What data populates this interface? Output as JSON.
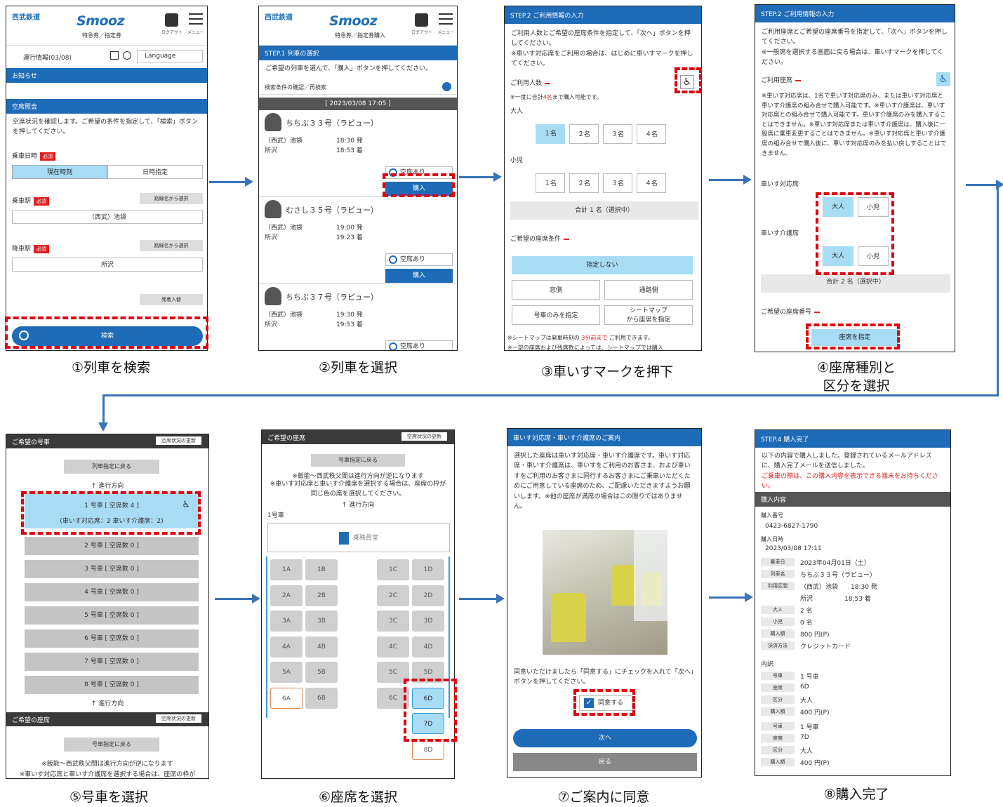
{
  "colors": {
    "accent": "#1e6bb8",
    "highlight": "#a8dcf5",
    "required": "#e02020",
    "flow_arrow": "#3a73b8"
  },
  "captions": [
    "①列車を検索",
    "②列車を選択",
    "③車いすマークを押下",
    "④座席種別と",
    "区分を選択",
    "⑤号車を選択",
    "⑥座席を選択",
    "⑦ご案内に同意",
    "⑧購入完了"
  ],
  "header": {
    "brand": "西武鉄道",
    "product": "Smooz",
    "sub1": "特急券／指定券",
    "sub2": "特急券／指定券購入",
    "logout": "ログアウト",
    "menu": "メニュー"
  },
  "s1": {
    "info": "運行情報(03/08)",
    "language": "Language",
    "notice": "お知らせ",
    "section": "空席照会",
    "desc": "空席状況を確認します。ご希望の条件を指定して、「検索」ボタンを押してください。",
    "date_label": "乗車日時",
    "required": "必須",
    "now": "現在時刻",
    "date_spec": "日時指定",
    "dep_label": "乗車駅",
    "line_select": "路線名から選択",
    "dep_value": "（西武）池袋",
    "arr_label": "降車駅",
    "arr_value": "所沢",
    "swap": "発着入替",
    "search": "検索"
  },
  "s2": {
    "step": "STEP.1 列車の選択",
    "desc": "ご希望の列車を選んで、「購入」ボタンを押してください。",
    "recheck": "検索条件の確認／再検索",
    "datetime": "[ 2023/03/08 17:05 ]",
    "avail": "空席あり",
    "buy": "購入",
    "trains": [
      {
        "name": "ちちぶ３３号（ラビュー）",
        "from": "（西武）池袋",
        "dep": "18:30 発",
        "to": "所沢",
        "arr": "18:53 着"
      },
      {
        "name": "むさし３５号（ラビュー）",
        "from": "（西武）池袋",
        "dep": "19:00 発",
        "to": "所沢",
        "arr": "19:23 着"
      },
      {
        "name": "ちちぶ３７号（ラビュー）",
        "from": "（西武）池袋",
        "dep": "19:30 発",
        "to": "所沢",
        "arr": "19:53 着"
      }
    ]
  },
  "s3": {
    "step": "STEP.2 ご利用情報の入力",
    "desc1": "ご利用人数とご希望の座席条件を指定して、「次へ」ボタンを押してください。",
    "desc2": "※車いす対応席をご利用の場合は、はじめに車いすマークを押してください。",
    "count_label": "ご利用人数",
    "limit_pre": "※一度に合計",
    "limit_num": "4名",
    "limit_post": "まで購入可能です。",
    "adult": "大人",
    "child": "小児",
    "counts": [
      "１名",
      "２名",
      "３名",
      "４名"
    ],
    "total": "合計 1 名（選択中）",
    "seat_cond": "ご希望の座席条件",
    "none": "指定しない",
    "window": "窓側",
    "aisle": "通路側",
    "car_only": "号車のみを指定",
    "seatmap1": "シートマップ",
    "seatmap2": "から座席を指定",
    "note1_pre": "※シートマップは発車時刻の",
    "note1_red": "3分前まで",
    "note1_post": "ご利用できます。",
    "note2": "※一部の座席および残席数によっては、シートマップでは購入"
  },
  "s4": {
    "step": "STEP.2 ご利用情報の入力",
    "desc1": "ご利用座席とご希望の座席番号を指定して、「次へ」ボタンを押してください。",
    "desc2": "※一般席を選択する画面に戻る場合は、車いすマークを押してください。",
    "seat_label": "ご利用座席",
    "notes": "※車いす対応席は、1名で車いす対応席のみ、または車いす対応席と車いす介護席の組み合せで購入可能です。※車いす介護席は、車いす対応席との組み合せで購入可能です。車いす介護席のみを購入することはできません。※車いす対応席または車いす介護席は、購入後に一般席に乗車変更することはできません。※車いす対応席と車いす介護席の組み合せで購入後に、車いす対応席のみを払い戻しすることはできません。",
    "wc": "車いす対応席",
    "care": "車いす介護席",
    "adult": "大人",
    "child": "小児",
    "total": "合計 2 名（選択中）",
    "seatno": "ご希望の座席番号",
    "pick": "座席を指定"
  },
  "s5": {
    "title": "ご希望の号車",
    "refresh": "空席状況の更新",
    "back": "列車指定に戻る",
    "direction": "↑ 進行方向",
    "car1": "1 号車 [ 空席数 4 ]",
    "car1_sub": "(車いす対応席：2  車いす介護席：2)",
    "cars": [
      "2 号車 [ 空席数 0 ]",
      "3 号車 [ 空席数 0 ]",
      "4 号車 [ 空席数 0 ]",
      "5 号車 [ 空席数 0 ]",
      "6 号車 [ 空席数 0 ]",
      "7 号車 [ 空席数 0 ]",
      "8 号車 [ 空席数 0 ]"
    ],
    "seat_title": "ご希望の座席",
    "back2": "号車指定に戻る",
    "note1": "※飯能〜西武秩父間は進行方向が逆になります",
    "note2": "※車いす対応席と車いす介護席を選択する場合は、座席の枠が"
  },
  "s6": {
    "title": "ご希望の座席",
    "refresh": "空席状況の更新",
    "back": "号車指定に戻る",
    "note1": "※飯能〜西武秩父間は進行方向が逆になります",
    "note2": "※車いす対応席と車いす介護席を選択する場合は、座席の枠が同じ色の席を選択してください。",
    "direction": "↑ 進行方向",
    "car": "1号車",
    "crew": "乗務員室",
    "seats": [
      "1A",
      "1B",
      "1C",
      "1D",
      "2A",
      "2B",
      "2C",
      "2D",
      "3A",
      "3B",
      "3C",
      "3D",
      "4A",
      "4B",
      "4C",
      "4D",
      "5A",
      "5B",
      "5C",
      "5D",
      "6A",
      "6B",
      "6C",
      "6D",
      "7D",
      "8D"
    ]
  },
  "s7": {
    "title": "車いす対応席・車いす介護席のご案内",
    "body": "選択した座席は車いす対応席・車いす介護席です。車いす対応席・車いす介護席は、車いすをご利用のお客さま、および車いすをご利用のお客さまに同行するお客さまにご乗車いただくためにご用意している座席のため、ご配慮いただきますようお願いします。※他の座席が満席の場合はこの限りではありません。",
    "agree_text": "同意いただけましたら「同意する」にチェックを入れて「次へ」ボタンを押してください。",
    "agree": "同意する",
    "next": "次へ",
    "back": "戻る"
  },
  "s8": {
    "step": "STEP.4 購入完了",
    "desc": "以下の内容で購入しました。登録されているメールアドレスに、購入完了メールを送信しました。",
    "warn": "ご乗車の際は、この購入内容を表示できる端末をお持ちください。",
    "section": "購入内容",
    "no_label": "購入番号",
    "no": "0423-6827-1790",
    "dt_label": "購入日時",
    "dt": "2023/03/08 17:11",
    "rows": [
      [
        "乗車日",
        "2023年04月01日（土）"
      ],
      [
        "列車名",
        "ちちぶ３３号（ラビュー）"
      ],
      [
        "利用区間",
        "（西武）池袋　　18:30 発"
      ],
      [
        "",
        "所沢　　　　　18:53 着"
      ],
      [
        "大人",
        "2 名"
      ],
      [
        "小児",
        "0 名"
      ],
      [
        "購入額",
        "800 円(P)"
      ],
      [
        "決済方法",
        "クレジットカード"
      ]
    ],
    "detail": "内訳",
    "d1": [
      [
        "号車",
        "1 号車"
      ],
      [
        "座席",
        "6D"
      ],
      [
        "区分",
        "大人"
      ],
      [
        "購入額",
        "400 円(P)"
      ]
    ],
    "d2": [
      [
        "号車",
        "1 号車"
      ],
      [
        "座席",
        "7D"
      ],
      [
        "区分",
        "大人"
      ],
      [
        "購入額",
        "400 円(P)"
      ]
    ]
  }
}
